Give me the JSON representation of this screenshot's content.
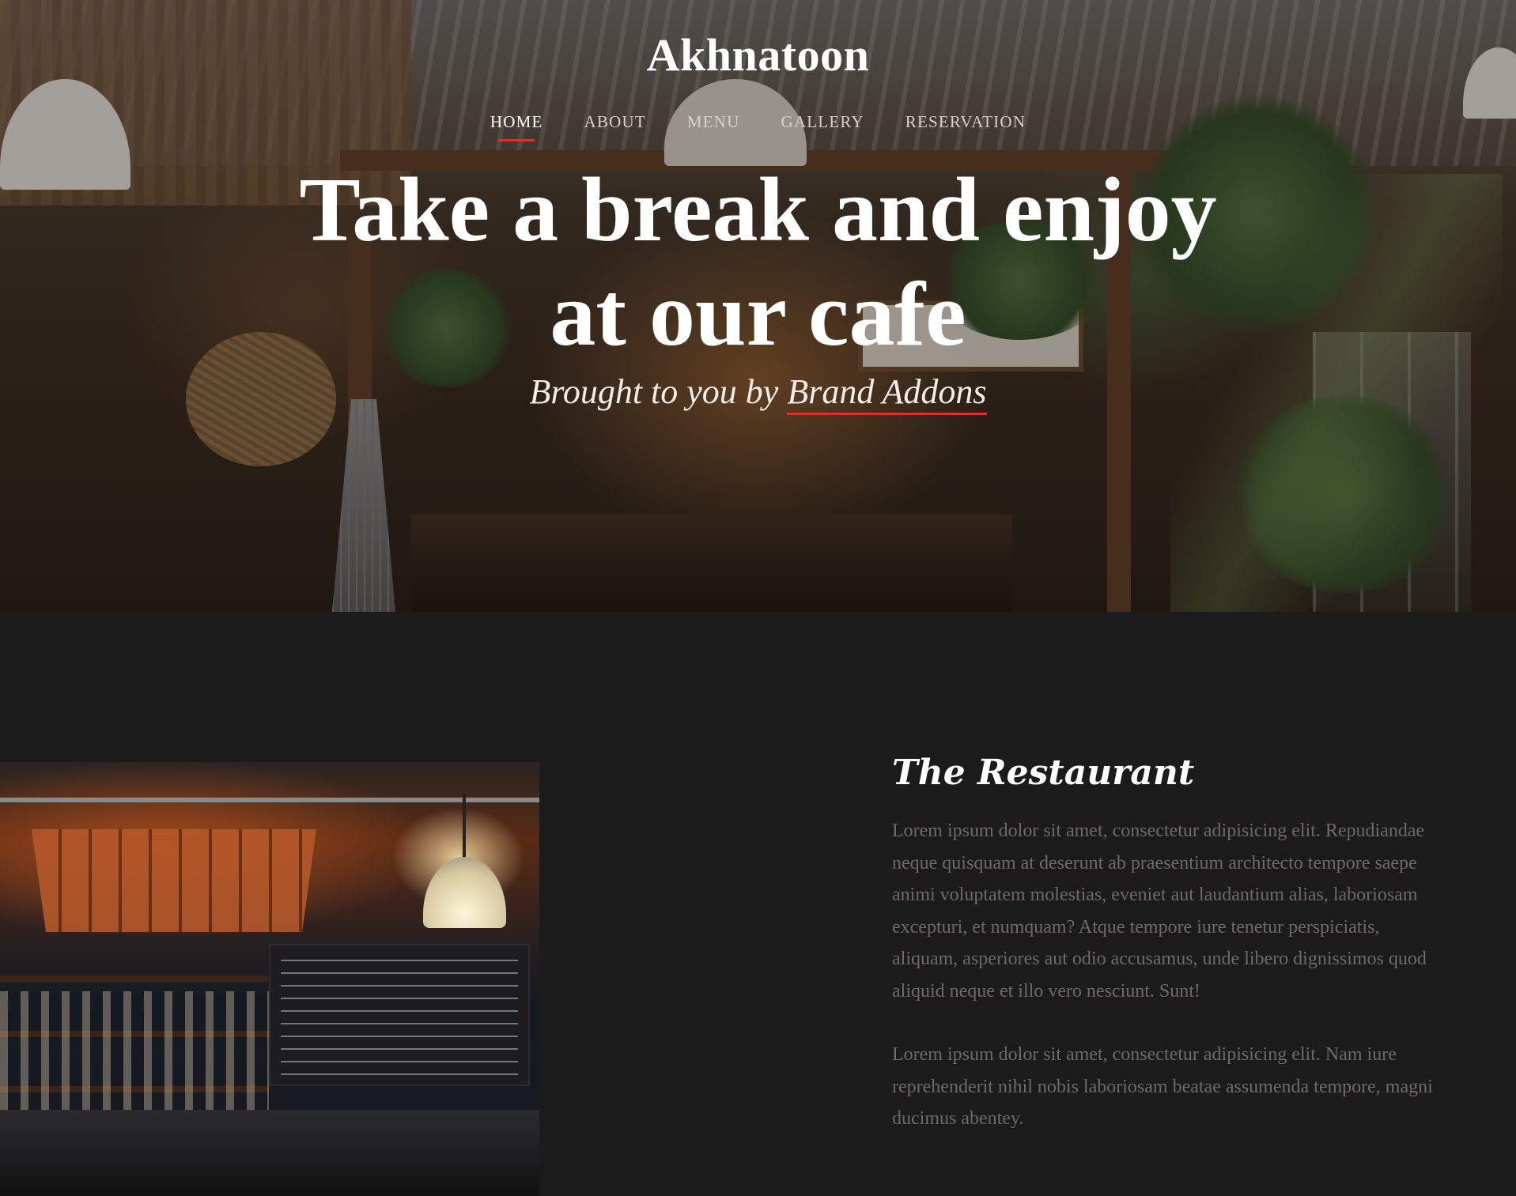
{
  "brand": "Akhnatoon",
  "nav": [
    "HOME",
    "ABOUT",
    "MENU",
    "GALLERY",
    "RESERVATION"
  ],
  "hero": {
    "title_line1": "Take a break and enjoy",
    "title_line2": "at our cafe",
    "subtitle_prefix": "Brought to you by",
    "subtitle_link": "Brand Addons"
  },
  "about": {
    "title": "The Restaurant",
    "paragraphs": [
      "Lorem ipsum dolor sit amet, consectetur adipisicing elit. Repudiandae neque quisquam at deserunt ab praesentium architecto tempore saepe animi voluptatem molestias, eveniet aut laudantium alias, laboriosam excepturi, et numquam? Atque tempore iure tenetur perspiciatis, aliquam, asperiores aut odio accusamus, unde libero dignissimos quod aliquid neque et illo vero nesciunt. Sunt!",
      "Lorem ipsum dolor sit amet, consectetur adipisicing elit. Nam iure reprehenderit nihil nobis laboriosam beatae assumenda tempore, magni ducimus abentey."
    ]
  },
  "colors": {
    "accent": "#d9322f",
    "background": "#1c1b1c",
    "body_text": "#6e6a68"
  }
}
